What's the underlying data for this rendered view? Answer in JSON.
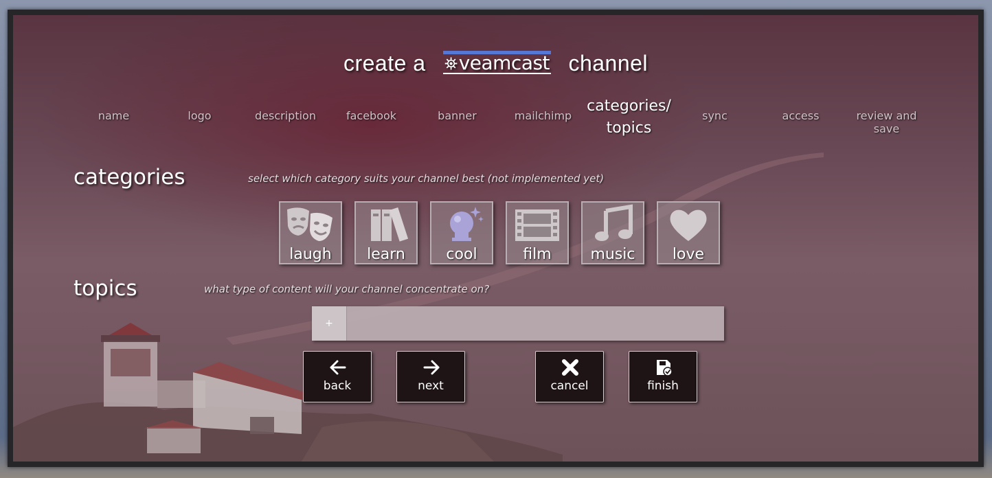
{
  "header": {
    "title_prefix": "create a",
    "brand": "veamcast",
    "title_suffix": "channel"
  },
  "steps": [
    {
      "label": "name",
      "active": false
    },
    {
      "label": "logo",
      "active": false
    },
    {
      "label": "description",
      "active": false
    },
    {
      "label": "facebook",
      "active": false
    },
    {
      "label": "banner",
      "active": false
    },
    {
      "label": "mailchimp",
      "active": false
    },
    {
      "label": "categories/",
      "label2": "topics",
      "active": true
    },
    {
      "label": "sync",
      "active": false
    },
    {
      "label": "access",
      "active": false
    },
    {
      "label": "review and save",
      "active": false
    }
  ],
  "categories": {
    "heading": "categories",
    "hint": "select which category suits your channel best (not implemented yet)",
    "items": [
      {
        "label": "laugh",
        "icon": "theater-masks-icon"
      },
      {
        "label": "learn",
        "icon": "books-icon"
      },
      {
        "label": "cool",
        "icon": "crystal-ball-icon"
      },
      {
        "label": "film",
        "icon": "film-strip-icon"
      },
      {
        "label": "music",
        "icon": "music-note-icon"
      },
      {
        "label": "love",
        "icon": "heart-icon"
      }
    ]
  },
  "topics": {
    "heading": "topics",
    "hint": "what type of content will your channel concentrate on?",
    "add_label": "+"
  },
  "actions": {
    "back": "back",
    "next": "next",
    "cancel": "cancel",
    "finish": "finish"
  },
  "colors": {
    "brand_accent": "#5577d6",
    "crystal_ball": "#a9a3d8",
    "button_bg": "#1e1416"
  }
}
